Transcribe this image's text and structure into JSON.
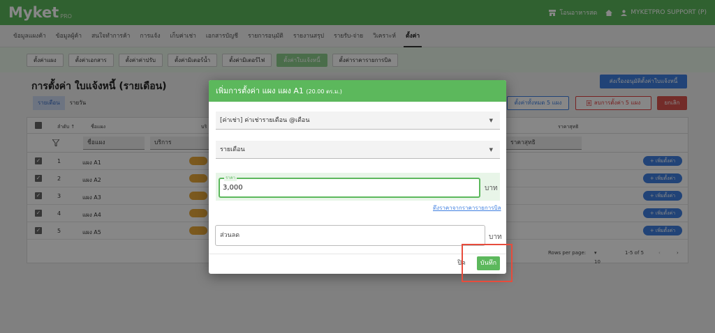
{
  "app": {
    "brand": "Myket",
    "brand_sub": "PRO",
    "shop_name": "โอนอาหารสด",
    "user": "MYKETPRO SUPPORT (P)"
  },
  "menu": [
    "ข้อมูลแผงค้า",
    "ข้อมูลผู้ค้า",
    "สนใจทำการค้า",
    "การแจ้ง",
    "เก็บค่าเช่า",
    "เอกสารบัญชี",
    "รายการอนุมัติ",
    "รายงานสรุป",
    "รายรับ-จ่าย",
    "วิเคราะห์",
    "ตั้งค่า"
  ],
  "menu_active": "ตั้งค่า",
  "subtabs": [
    "ตั้งค่าแผง",
    "ตั้งค่าเอกสาร",
    "ตั้งค่าค่าปรับ",
    "ตั้งค่ามิเตอร์น้ำ",
    "ตั้งค่ามิเตอร์ไฟ",
    "ตั้งค่าใบแจ้งหนี้",
    "ตั้งค่าราคารายการบิล"
  ],
  "subtab_active": "ตั้งค่าใบแจ้งหนี้",
  "page": {
    "title": "การตั้งค่า ใบแจ้งหนี้ (รายเดือน)",
    "tabs": [
      "รายเดือน",
      "รายวัน"
    ],
    "tab_active": "รายเดือน"
  },
  "actions": {
    "send": "ส่งเรื่องอนุมัติตั้งค่าใบแจ้งหนี้",
    "set_all": "ตั้งค่าทั้งหมด 5 แผง",
    "delete_all": "ลบการตั้งค่า 5 แผง",
    "cancel": "ยกเลิก"
  },
  "table": {
    "headers": {
      "order": "ลำดับ ↑",
      "name": "ชื่อแผง",
      "service": "บริ",
      "net": "ราคาสุทธิ"
    },
    "filters": {
      "name": "ชื่อแผง",
      "service": "บริการ",
      "net": "ราคาสุทธิ"
    },
    "rows": [
      {
        "num": "1",
        "name": "แผง A1"
      },
      {
        "num": "2",
        "name": "แผง A2"
      },
      {
        "num": "3",
        "name": "แผง A3"
      },
      {
        "num": "4",
        "name": "แผง A4"
      },
      {
        "num": "5",
        "name": "แผง A5"
      }
    ],
    "add_label": "+ เพิ่มตั้งค่า",
    "pager": {
      "rows_label": "Rows per page:",
      "rows_value": "10",
      "range": "1-5 of 5"
    }
  },
  "modal": {
    "title": "เพิ่มการตั้งค่า แผง แผง A1",
    "area": "(20.00 ตร.ม.)",
    "select1": "[ค่าเช่า] ค่าเช่ารายเดือน @เดือน",
    "select2": "รายเดือน",
    "price_label": "ราคา",
    "price_value": "3,000",
    "price_unit": "บาท",
    "link": "ดึงราคาจากราคารายการบิล",
    "discount_placeholder": "ส่วนลด",
    "discount_unit": "บาท",
    "cancel": "ปิด",
    "save": "บันทึก"
  }
}
